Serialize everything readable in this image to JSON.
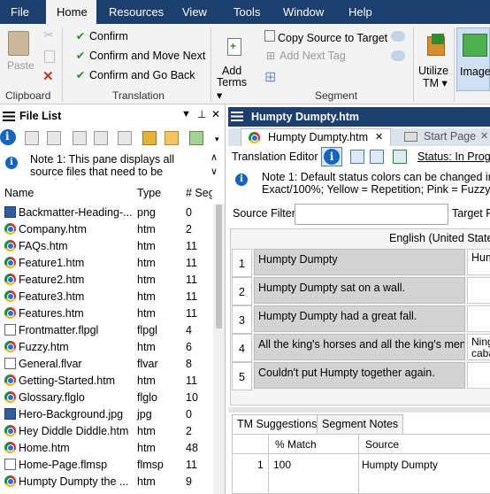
{
  "menubar": {
    "items": [
      {
        "label": "File"
      },
      {
        "label": "Home",
        "active": true
      },
      {
        "label": "Resources"
      },
      {
        "label": "View"
      },
      {
        "label": "Tools"
      },
      {
        "label": "Window"
      },
      {
        "label": "Help"
      }
    ]
  },
  "ribbon": {
    "clipboard": {
      "paste_label": "Paste",
      "group_label": "Clipboard"
    },
    "translation": {
      "confirm": "Confirm",
      "confirm_next": "Confirm and Move Next",
      "confirm_back": "Confirm and Go Back",
      "group_label": "Translation"
    },
    "segment": {
      "add_terms_1": "Add",
      "add_terms_2": "Terms",
      "copy_source": "Copy Source to Target",
      "add_next_tag": "Add Next Tag",
      "group_label": "Segment"
    },
    "utilize_tm_1": "Utilize",
    "utilize_tm_2": "TM",
    "images_label": "Images"
  },
  "file_list": {
    "title": "File List",
    "note": "Note 1: This pane displays all source files that need to be translated. Yo",
    "columns": {
      "name": "Name",
      "type": "Type",
      "segments": "# Seg"
    },
    "files": [
      {
        "name": "Backmatter-Heading-...",
        "type": "png",
        "segments": "0",
        "icon": "image-file-icon"
      },
      {
        "name": "Company.htm",
        "type": "htm",
        "segments": "2",
        "icon": "chrome-icon"
      },
      {
        "name": "FAQs.htm",
        "type": "htm",
        "segments": "11",
        "icon": "chrome-icon"
      },
      {
        "name": "Feature1.htm",
        "type": "htm",
        "segments": "11",
        "icon": "chrome-icon"
      },
      {
        "name": "Feature2.htm",
        "type": "htm",
        "segments": "11",
        "icon": "chrome-icon"
      },
      {
        "name": "Feature3.htm",
        "type": "htm",
        "segments": "11",
        "icon": "chrome-icon"
      },
      {
        "name": "Features.htm",
        "type": "htm",
        "segments": "11",
        "icon": "chrome-icon"
      },
      {
        "name": "Frontmatter.flpgl",
        "type": "flpgl",
        "segments": "4",
        "icon": "document-file-icon"
      },
      {
        "name": "Fuzzy.htm",
        "type": "htm",
        "segments": "6",
        "icon": "chrome-icon"
      },
      {
        "name": "General.flvar",
        "type": "flvar",
        "segments": "8",
        "icon": "document-file-icon"
      },
      {
        "name": "Getting-Started.htm",
        "type": "htm",
        "segments": "11",
        "icon": "chrome-icon"
      },
      {
        "name": "Glossary.flglo",
        "type": "flglo",
        "segments": "10",
        "icon": "chrome-icon"
      },
      {
        "name": "Hero-Background.jpg",
        "type": "jpg",
        "segments": "0",
        "icon": "image-file-icon"
      },
      {
        "name": "Hey Diddle Diddle.htm",
        "type": "htm",
        "segments": "2",
        "icon": "chrome-icon"
      },
      {
        "name": "Home.htm",
        "type": "htm",
        "segments": "48",
        "icon": "chrome-icon"
      },
      {
        "name": "Home-Page.flmsp",
        "type": "flmsp",
        "segments": "11",
        "icon": "document-file-icon"
      },
      {
        "name": "Humpty Dumpty the ...",
        "type": "htm",
        "segments": "9",
        "icon": "chrome-icon"
      }
    ]
  },
  "editor": {
    "window_title": "Humpty Dumpty.htm",
    "tabs": [
      {
        "label": "Humpty Dumpty.htm",
        "active": true
      },
      {
        "label": "Start Page",
        "active": false
      }
    ],
    "toolbar_title": "Translation Editor",
    "status": "Status: In Progre",
    "note_line1": "Note 1: Default status colors can be changed in O",
    "note_line2": "Exact/100%; Yellow = Repetition; Pink = Fuzzy; Re",
    "source_filter_label": "Source Filter:",
    "target_filter_label": "Target Fi",
    "column_header": "English (United States",
    "segments": [
      {
        "num": "1",
        "source": "Humpty Dumpty",
        "target": "Hum"
      },
      {
        "num": "2",
        "source": "Humpty Dumpty sat on a wall.",
        "target": ""
      },
      {
        "num": "3",
        "source": "Humpty Dumpty had a great fall.",
        "target": ""
      },
      {
        "num": "4",
        "source": "All the king's horses and all the king's men",
        "target": "Ning caba"
      },
      {
        "num": "5",
        "source": "Couldn't put Humpty together again.",
        "target": ""
      }
    ],
    "bottom_tabs": {
      "tm_suggestions": "TM Suggestions",
      "segment_notes": "Segment Notes"
    },
    "tm_columns": {
      "match": "% Match",
      "source": "Source"
    },
    "tm_rows": [
      {
        "num": "1",
        "match": "100",
        "source": "Humpty Dumpty"
      }
    ]
  }
}
